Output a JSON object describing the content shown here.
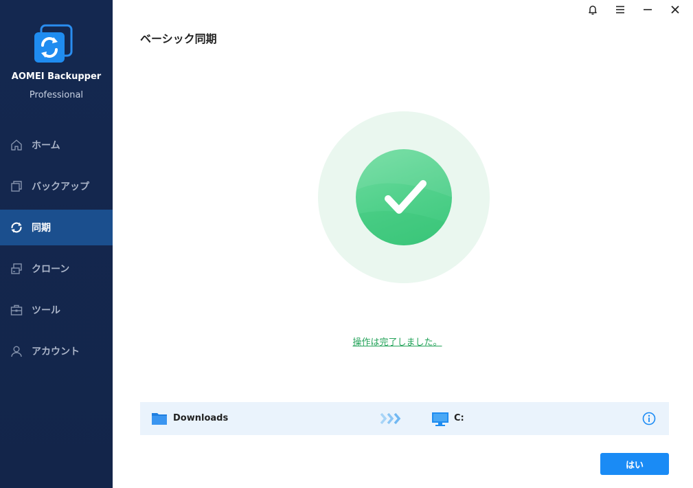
{
  "app": {
    "name": "AOMEI Backupper",
    "edition": "Professional"
  },
  "sidebar": {
    "items": [
      {
        "label": "ホーム",
        "icon": "home-icon",
        "active": false
      },
      {
        "label": "バックアップ",
        "icon": "backup-icon",
        "active": false
      },
      {
        "label": "同期",
        "icon": "sync-icon",
        "active": true
      },
      {
        "label": "クローン",
        "icon": "clone-icon",
        "active": false
      },
      {
        "label": "ツール",
        "icon": "tools-icon",
        "active": false
      },
      {
        "label": "アカウント",
        "icon": "account-icon",
        "active": false
      }
    ]
  },
  "window_controls": [
    "bell-icon",
    "menu-icon",
    "minimize-icon",
    "close-icon"
  ],
  "page": {
    "title": "ベーシック同期",
    "status_message": "操作は完了しました。"
  },
  "task": {
    "source": "Downloads",
    "destination": "C:"
  },
  "footer": {
    "ok_label": "はい"
  },
  "colors": {
    "sidebar_bg": "#142850",
    "active_item": "#1b4f8e",
    "success_green": "#4fd08a",
    "accent_blue": "#1a8bf5",
    "link_green": "#24a35a"
  }
}
